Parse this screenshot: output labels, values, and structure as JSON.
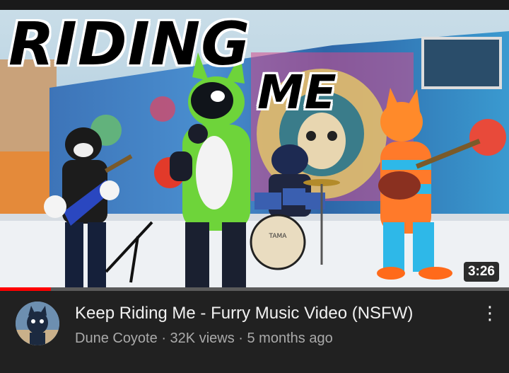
{
  "thumbnail": {
    "overlay_title_line1": "RIDING",
    "overlay_title_line2": "ME",
    "drum_brand": "TAMA",
    "duration": "3:26",
    "watch_progress": 0.1
  },
  "video": {
    "title": "Keep Riding Me - Furry Music Video (NSFW)",
    "channel": "Dune Coyote",
    "views": "32K views",
    "age": "5 months ago",
    "separator": "·",
    "more_icon": "vertical-ellipsis-icon"
  },
  "colors": {
    "background": "#212121",
    "progress": "#ff0000",
    "title_text": "#f1f1f1",
    "meta_text": "#aaaaaa"
  }
}
